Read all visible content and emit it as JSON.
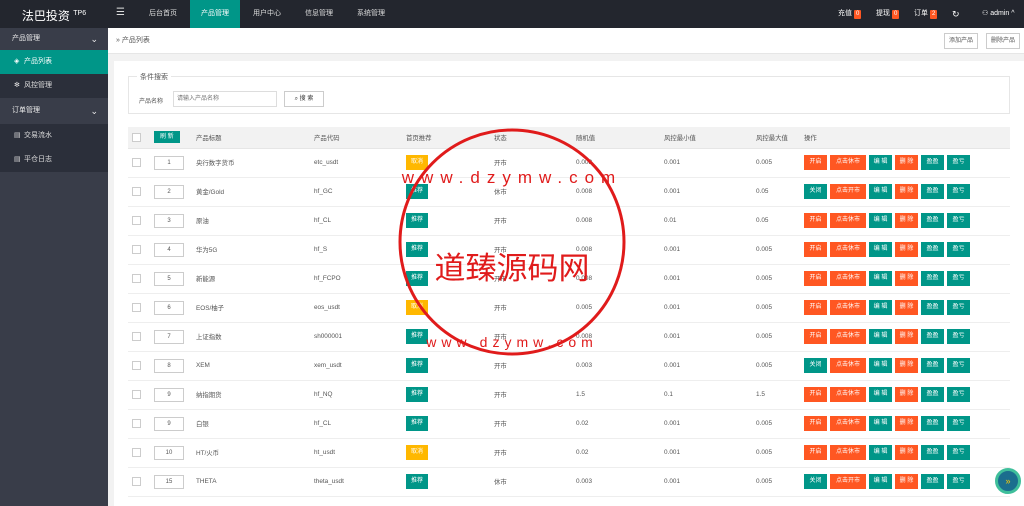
{
  "app": {
    "logo": "法巴投资",
    "logo_sup": "TP6"
  },
  "topnav": [
    "后台首页",
    "产品管理",
    "用户中心",
    "信息管理",
    "系统管理"
  ],
  "topright": {
    "recharge": "充值",
    "recharge_count": "0",
    "withdraw": "提现",
    "withdraw_count": "0",
    "orders": "订单",
    "orders_count": "2",
    "user": "admin"
  },
  "sidebar": {
    "groups": [
      {
        "label": "产品管理",
        "items": [
          "产品列表",
          "风控管理"
        ]
      },
      {
        "label": "订单管理",
        "items": [
          "交易流水",
          "平仓日志"
        ]
      }
    ]
  },
  "tabbar": {
    "breadcrumb": "产品列表",
    "add": "添加产品",
    "delete": "删除产品"
  },
  "search": {
    "legend": "条件搜索",
    "label": "产品名称",
    "placeholder": "请输入产品名称",
    "button": "搜 索"
  },
  "table": {
    "headers": [
      "",
      "刷 新",
      "产品标题",
      "产品代码",
      "首页推荐",
      "状态",
      "随机值",
      "风控最小值",
      "风控最大值",
      "操作"
    ],
    "rows": [
      [
        "1",
        "央行数字货币",
        "etc_usdt",
        "取消",
        "开市",
        "0.008",
        "0.001",
        "0.005",
        "开启"
      ],
      [
        "2",
        "黄金/Gold",
        "hf_GC",
        "推荐",
        "休市",
        "0.008",
        "0.001",
        "0.05",
        "关闭"
      ],
      [
        "3",
        "原油",
        "hf_CL",
        "推荐",
        "开市",
        "0.008",
        "0.01",
        "0.05",
        "开启"
      ],
      [
        "4",
        "华为5G",
        "hf_S",
        "推荐",
        "开市",
        "0.008",
        "0.001",
        "0.005",
        "开启"
      ],
      [
        "5",
        "新能源",
        "hf_FCPO",
        "推荐",
        "开市",
        "0.008",
        "0.001",
        "0.005",
        "开启"
      ],
      [
        "6",
        "EOS/柚子",
        "eos_usdt",
        "取消",
        "开市",
        "0.005",
        "0.001",
        "0.005",
        "开启"
      ],
      [
        "7",
        "上证指数",
        "sh000001",
        "推荐",
        "开市",
        "0.008",
        "0.001",
        "0.005",
        "开启"
      ],
      [
        "8",
        "XEM",
        "xem_usdt",
        "推荐",
        "开市",
        "0.003",
        "0.001",
        "0.005",
        "关闭"
      ],
      [
        "9",
        "纳指期货",
        "hf_NQ",
        "推荐",
        "开市",
        "1.5",
        "0.1",
        "1.5",
        "开启"
      ],
      [
        "9",
        "白银",
        "hf_CL",
        "推荐",
        "开市",
        "0.02",
        "0.001",
        "0.005",
        "开启"
      ],
      [
        "10",
        "HT/火币",
        "ht_usdt",
        "取消",
        "开市",
        "0.02",
        "0.001",
        "0.005",
        "开启"
      ],
      [
        "15",
        "THETA",
        "theta_usdt",
        "推荐",
        "休市",
        "0.003",
        "0.001",
        "0.005",
        "关闭"
      ]
    ],
    "actions": [
      "点击休市",
      "编 辑",
      "删 除",
      "盈盈",
      "盈亏"
    ],
    "action_pluses": "点击开市"
  },
  "watermark": {
    "url_text": "www.dzymw.com",
    "title": "道臻源码网"
  },
  "colors": {
    "accent": "#009688",
    "danger": "#ff5722",
    "warn": "#ffb800",
    "dark": "#23262e",
    "stamp": "#e01b1b"
  }
}
